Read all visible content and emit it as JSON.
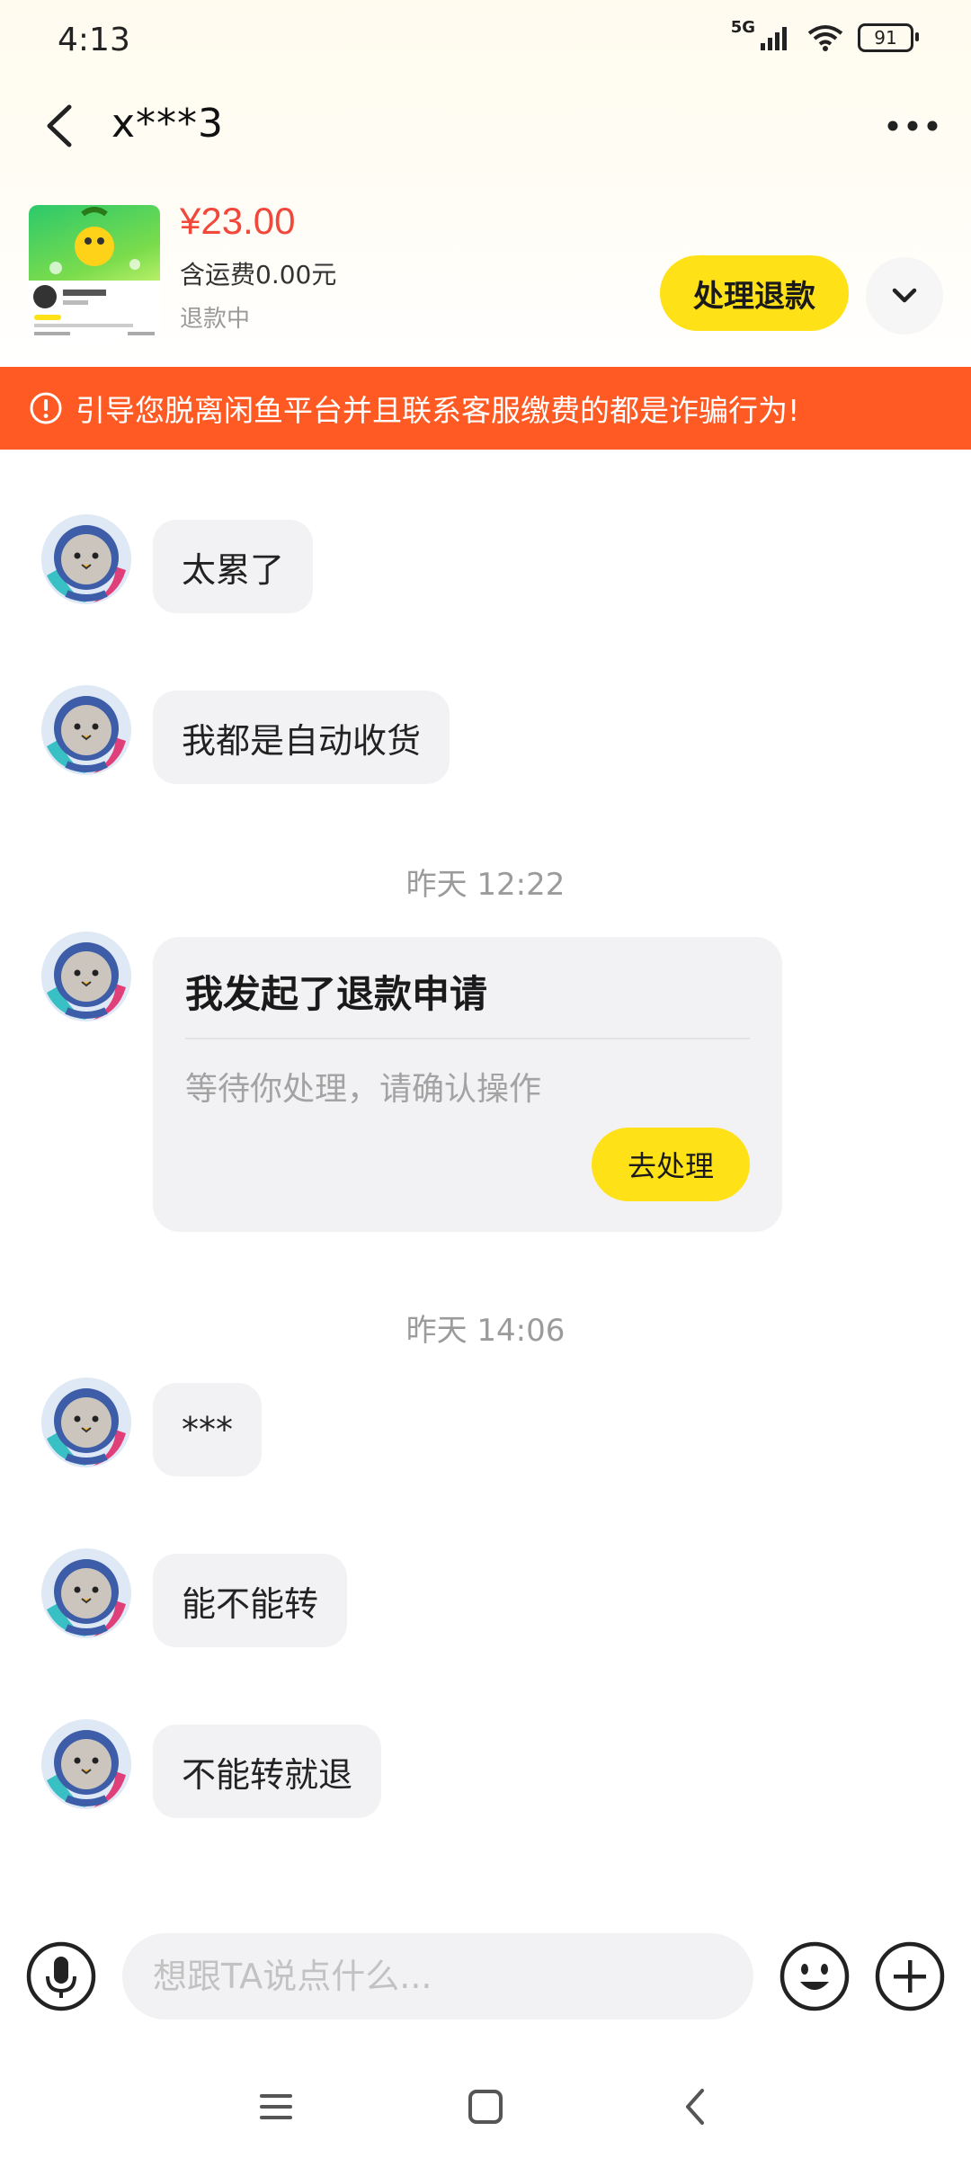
{
  "status_bar": {
    "time": "4:13",
    "network": "5G",
    "battery": "91"
  },
  "header": {
    "title": "x***3"
  },
  "product": {
    "price": "¥23.00",
    "shipping": "含运费0.00元",
    "status": "退款中",
    "action_label": "处理退款"
  },
  "warning": {
    "text": "引导您脱离闲鱼平台并且联系客服缴费的都是诈骗行为!"
  },
  "messages": [
    {
      "text": "太累了"
    },
    {
      "text": "我都是自动收货"
    },
    {
      "timestamp": "昨天 12:22"
    },
    {
      "card_title": "我发起了退款申请",
      "card_subtitle": "等待你处理，请确认操作",
      "card_button": "去处理"
    },
    {
      "timestamp": "昨天 14:06"
    },
    {
      "text": "***"
    },
    {
      "text": "能不能转"
    },
    {
      "text": "不能转就退"
    }
  ],
  "input": {
    "placeholder": "想跟TA说点什么..."
  },
  "colors": {
    "accent_yellow": "#ffe117",
    "warning_orange": "#ff5a23",
    "price_red": "#f0483b"
  }
}
